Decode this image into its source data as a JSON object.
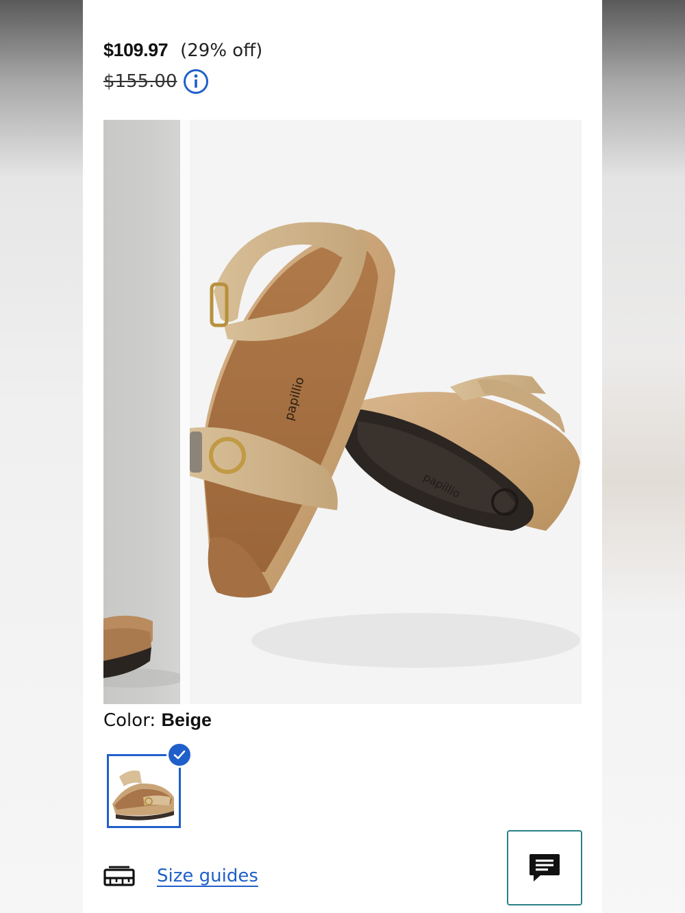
{
  "price": {
    "current": "$109.97",
    "discount": "(29% off)",
    "original": "$155.00"
  },
  "gallery": {
    "brand_print": "papillio"
  },
  "color": {
    "label": "Color:",
    "value": "Beige"
  },
  "size": {
    "link_label": "Size guides"
  },
  "colors": {
    "accent": "#1f5fc9",
    "chat_border": "#2a7f86"
  },
  "icons": {
    "info": "info-icon",
    "check": "check-icon",
    "size_guide": "ruler-icon",
    "chat": "chat-icon"
  }
}
